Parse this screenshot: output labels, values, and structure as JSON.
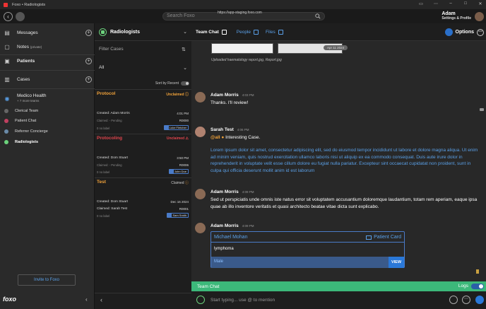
{
  "window": {
    "title": "Foxo • Radiologists",
    "url": "https://app-staging.foxo.com"
  },
  "search": {
    "placeholder": "Search Foxo"
  },
  "user": {
    "name": "Adam",
    "subtitle": "Settings & Profile"
  },
  "sidebar": {
    "messages": "Messages",
    "notes": "Notes",
    "notes_tag": "(private)",
    "patients": "Patients",
    "cases": "Cases",
    "org_name": "Medico Health",
    "org_sub": "+ 7 more teams",
    "teams": [
      {
        "label": "Clerical Team"
      },
      {
        "label": "Patient Chat"
      },
      {
        "label": "Referrer Concierge"
      },
      {
        "label": "Radiologists"
      }
    ],
    "invite": "Invite to Foxo",
    "brand": "foxo"
  },
  "cases_panel": {
    "title": "Radiologists",
    "filter_placeholder": "Filter Cases",
    "filter_value": "All",
    "sort_label": "Sort by Recent",
    "cases": [
      {
        "title": "Protocol",
        "title_color": "#f2a33a",
        "status": "Unclaimed",
        "status_color": "#f2a33a",
        "created": "Created: Adam Morris",
        "time": "4:01 PM",
        "claimed": "Claimed: - Pending",
        "amount": "R0000",
        "labels": "0 no label",
        "assignee": "Luke Fletcher"
      },
      {
        "title": "Protocoling",
        "title_color": "#e0444c",
        "status": "Unclaimed",
        "status_color": "#e0444c",
        "created": "Created: Dom Stuart",
        "time": "3:50 PM",
        "claimed": "Claimed: - Pending",
        "amount": "R0006",
        "labels": "0 no label",
        "assignee": "John Doe"
      },
      {
        "title": "Test",
        "title_color": "#f2a33a",
        "status": "Claimed",
        "status_color": "#cccccc",
        "created": "Created: Dom Stuart",
        "time": "Dec 16 2024",
        "claimed": "Claimed: Sarah Test",
        "amount": "R0001",
        "labels": "0 no label",
        "assignee": "Sam Smith"
      }
    ]
  },
  "chat": {
    "tabs": {
      "team": "Team Chat",
      "people": "People",
      "files": "Files"
    },
    "options": "Options",
    "date_pill": "Apr 11 2024",
    "uploaded": "Uploaded haematology report.jpg, Report.jpg",
    "messages": [
      {
        "author": "Adam Morris",
        "time": "4:03 PM",
        "text": "Thanks. I'll review!"
      },
      {
        "author": "Sarah Test",
        "time": "4:06 PM",
        "mention": "@all",
        "text": "Interesting Case.",
        "body": "Lorem ipsum dolor sit amet, consectetur adipiscing elit, sed do eiusmod tempor incididunt ut labore et dolore magna aliqua. Ut enim ad minim veniam, quis nostrud exercitation ullamco laboris nisi ut aliquip ex ea commodo consequat. Duis aute irure dolor in reprehenderit in voluptate velit esse cillum dolore eu fugiat nulla pariatur. Excepteur sint occaecat cupidatat non proident, sunt in culpa qui officia deserunt mollit anim id est laborum"
      },
      {
        "author": "Adam Morris",
        "time": "4:09 PM",
        "text": "Sed ut perspiciatis unde omnis iste natus error sit voluptatem accusantium doloremque laudantium, totam rem aperiam, eaque ipsa quae ab illo inventore veritatis et quasi architecto beatae vitae dicta sunt explicabo."
      },
      {
        "author": "Adam Morris",
        "time": "4:09 PM"
      }
    ],
    "patient_card": {
      "name": "Michael Mohan",
      "link": "Patient Card",
      "diagnosis": "lymphoma",
      "gender": "Male",
      "view": "VIEW"
    },
    "team_bar": "Team Chat",
    "logs": "Logs",
    "composer_placeholder": "Start typing... use @ to mention"
  }
}
